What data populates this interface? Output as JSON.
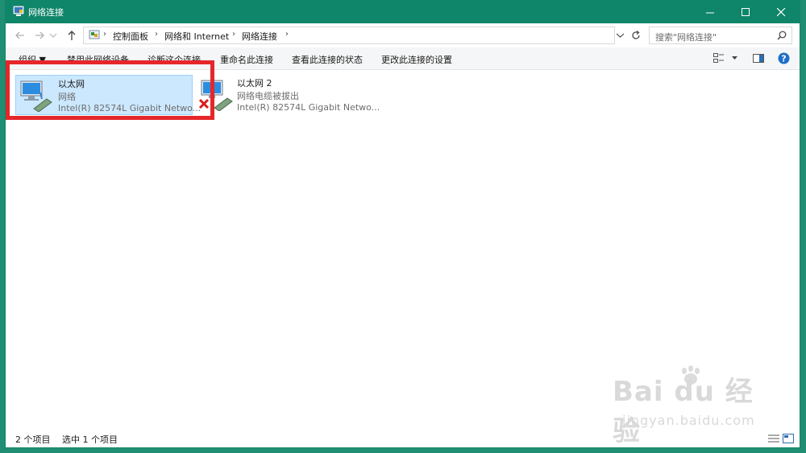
{
  "window": {
    "title": "网络连接"
  },
  "address": {
    "segments": [
      "控制面板",
      "网络和 Internet",
      "网络连接"
    ]
  },
  "search": {
    "placeholder": "搜索\"网络连接\""
  },
  "toolbar": {
    "organize": "组织 ▼",
    "disable": "禁用此网络设备",
    "diagnose": "诊断这个连接",
    "rename": "重命名此连接",
    "view_status": "查看此连接的状态",
    "change_settings": "更改此连接的设置"
  },
  "connections": [
    {
      "name": "以太网",
      "status": "网络",
      "adapter": "Intel(R) 82574L Gigabit Netwo...",
      "selected": true
    },
    {
      "name": "以太网 2",
      "status": "网络电缆被拔出",
      "adapter": "Intel(R) 82574L Gigabit Netwo...",
      "selected": false,
      "disconnected": true
    }
  ],
  "statusbar": {
    "count": "2 个项目",
    "selected": "选中 1 个项目"
  },
  "watermark": {
    "main": "Bai du 经验",
    "sub": "jingyan.baidu.com"
  },
  "colors": {
    "titlebar": "#0f8569",
    "selection": "#cce8ff",
    "highlight": "#e5272b"
  }
}
